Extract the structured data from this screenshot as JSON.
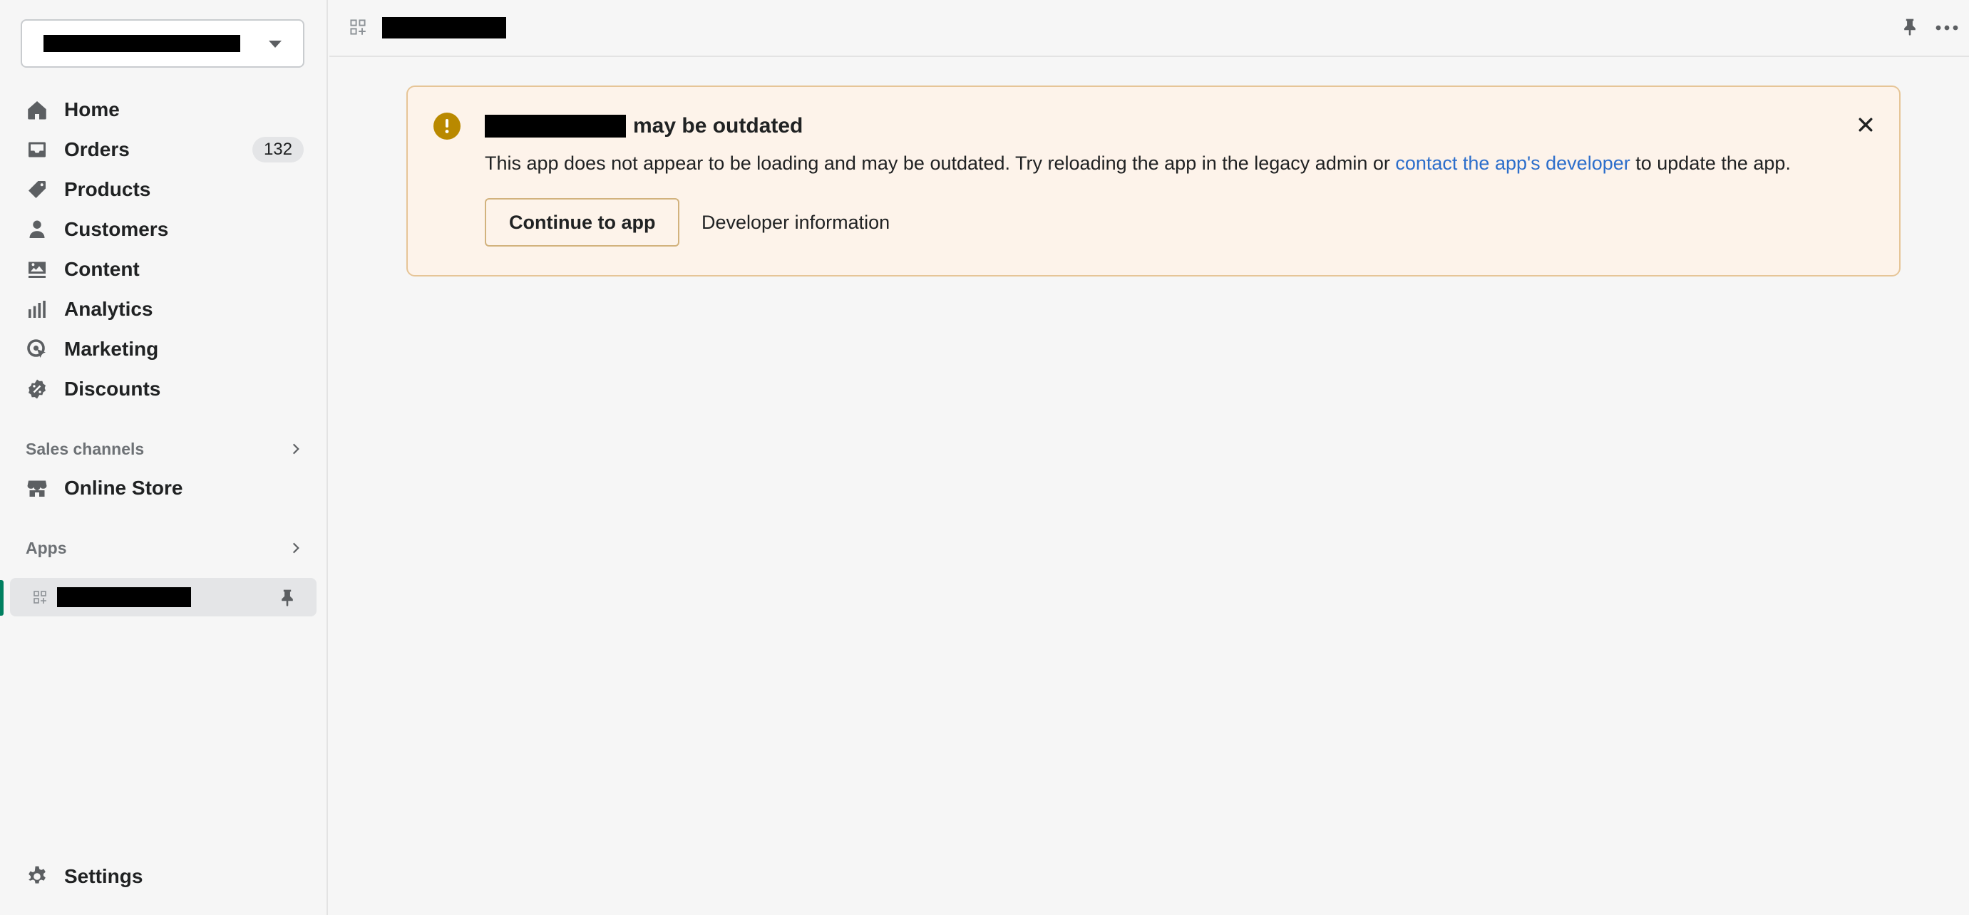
{
  "sidebar": {
    "store_selector": {
      "value_redacted": true
    },
    "nav": [
      {
        "label": "Home",
        "icon": "home-icon"
      },
      {
        "label": "Orders",
        "icon": "orders-icon",
        "badge": "132"
      },
      {
        "label": "Products",
        "icon": "tag-icon"
      },
      {
        "label": "Customers",
        "icon": "person-icon"
      },
      {
        "label": "Content",
        "icon": "image-icon"
      },
      {
        "label": "Analytics",
        "icon": "bar-chart-icon"
      },
      {
        "label": "Marketing",
        "icon": "target-icon"
      },
      {
        "label": "Discounts",
        "icon": "discount-icon"
      }
    ],
    "sales_channels": {
      "label": "Sales channels",
      "items": [
        {
          "label": "Online Store",
          "icon": "store-icon"
        }
      ]
    },
    "apps": {
      "label": "Apps",
      "active_app_redacted": true
    },
    "settings_label": "Settings"
  },
  "topbar": {
    "app_icon": "app-grid-icon",
    "title_redacted": true
  },
  "banner": {
    "title_suffix": "may be outdated",
    "message_before_link": "This app does not appear to be loading and may be outdated. Try reloading the app in the legacy admin or ",
    "link_text": "contact the app's developer",
    "message_after_link": " to update the app.",
    "primary_button": "Continue to app",
    "secondary_button": "Developer information"
  },
  "colors": {
    "link": "#2c6ecb",
    "warning_bg": "#fdf3ea",
    "warning_icon": "#b98900",
    "active_indicator": "#008060"
  }
}
